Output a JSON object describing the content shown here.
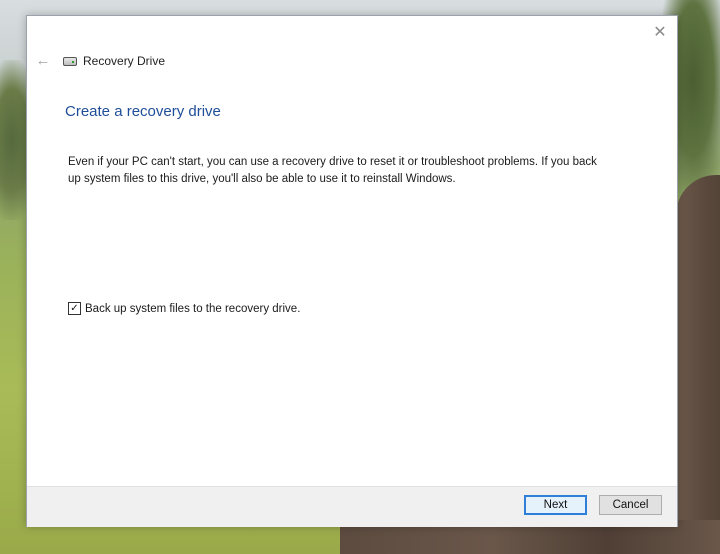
{
  "window": {
    "title": "Recovery Drive",
    "close_glyph": "✕",
    "back_glyph": "←",
    "icons": [
      "drive-icon",
      "back-arrow-icon",
      "close-icon"
    ]
  },
  "main": {
    "heading": "Create a recovery drive",
    "description": "Even if your PC can't start, you can use a recovery drive to reset it or troubleshoot problems. If you back up system files to this drive, you'll also be able to use it to reinstall Windows.",
    "checkbox": {
      "label": "Back up system files to the recovery drive.",
      "checked": true,
      "glyph": "✓"
    }
  },
  "footer": {
    "next_label": "Next",
    "cancel_label": "Cancel"
  },
  "colors": {
    "heading": "#1f4e99",
    "default_button_border": "#2f7ed8"
  }
}
